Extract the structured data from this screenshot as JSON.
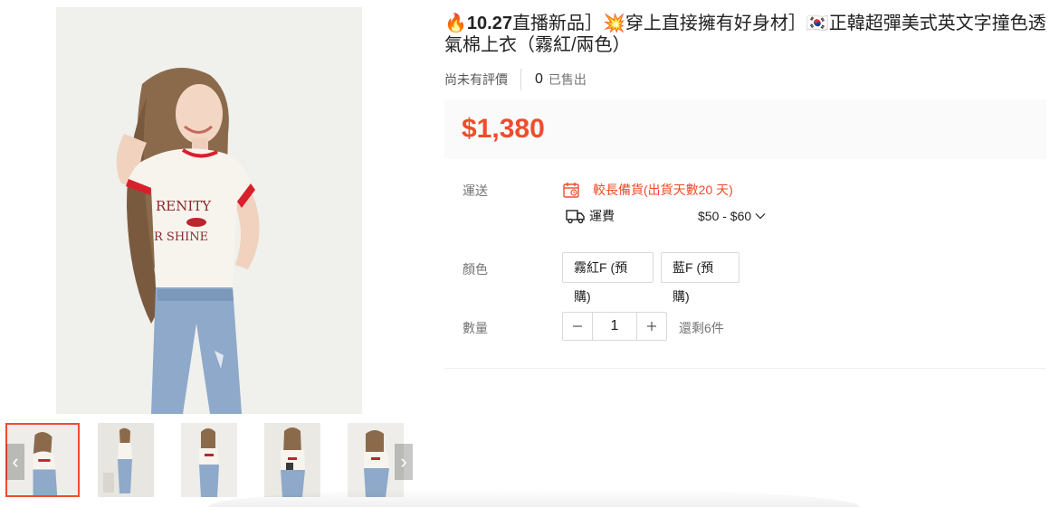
{
  "product": {
    "title_prefix_icon": "fire-emoji",
    "title_bold": "10.27",
    "title_part1": "直播新品］",
    "title_burst_icon": "collision-emoji",
    "title_part2": "穿上直接擁有好身材］",
    "title_flag_icon": "korea-flag-emoji",
    "title_part3": "正韓超彈美式英文字撞色透氣棉上衣（霧紅/兩色）"
  },
  "stats": {
    "rating_text": "尚未有評價",
    "sold_count": "0",
    "sold_label": "已售出"
  },
  "price": {
    "value": "$1,380",
    "color": "#ee4d2d"
  },
  "shipping": {
    "label": "運送",
    "preorder_text": "較長備貨(出貨天數20 天)",
    "fee_label": "運費",
    "fee_range": "$50 - $60",
    "calendar_icon": "calendar-icon",
    "truck_icon": "truck-icon"
  },
  "color_option": {
    "label": "顏色",
    "options": [
      "霧紅F (預購)",
      "藍F (預購)"
    ]
  },
  "quantity": {
    "label": "數量",
    "value": "1",
    "stock_text": "還剩6件"
  },
  "gallery": {
    "thumbnail_count": 5,
    "active_index": 0,
    "accent_color": "#ee4d2d"
  }
}
